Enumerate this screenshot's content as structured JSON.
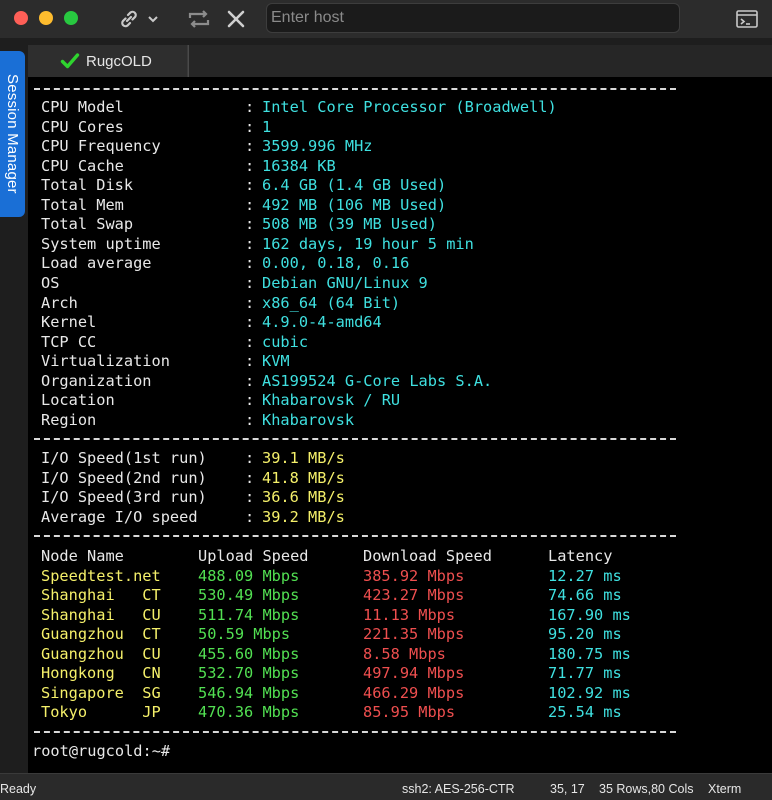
{
  "window": {
    "host_placeholder": "Enter host",
    "icons": [
      "link-icon",
      "chevron-down-icon",
      "reconnect-icon",
      "close-icon",
      "terminal-panel-icon"
    ]
  },
  "sidebar": {
    "session_manager_label": "Session Manager"
  },
  "tabs": [
    {
      "label": "RugcOLD",
      "status_icon": "check-icon"
    }
  ],
  "terminal": {
    "system_info": [
      {
        "key": "CPU Model",
        "value": "Intel Core Processor (Broadwell)"
      },
      {
        "key": "CPU Cores",
        "value": "1"
      },
      {
        "key": "CPU Frequency",
        "value": "3599.996 MHz"
      },
      {
        "key": "CPU Cache",
        "value": "16384 KB"
      },
      {
        "key": "Total Disk",
        "value": "6.4 GB (1.4 GB Used)"
      },
      {
        "key": "Total Mem",
        "value": "492 MB (106 MB Used)"
      },
      {
        "key": "Total Swap",
        "value": "508 MB (39 MB Used)"
      },
      {
        "key": "System uptime",
        "value": "162 days, 19 hour 5 min"
      },
      {
        "key": "Load average",
        "value": "0.00, 0.18, 0.16"
      },
      {
        "key": "OS",
        "value": "Debian GNU/Linux 9"
      },
      {
        "key": "Arch",
        "value": "x86_64 (64 Bit)"
      },
      {
        "key": "Kernel",
        "value": "4.9.0-4-amd64"
      },
      {
        "key": "TCP CC",
        "value": "cubic"
      },
      {
        "key": "Virtualization",
        "value": "KVM"
      },
      {
        "key": "Organization",
        "value": "AS199524 G-Core Labs S.A."
      },
      {
        "key": "Location",
        "value": "Khabarovsk / RU"
      },
      {
        "key": "Region",
        "value": "Khabarovsk"
      }
    ],
    "io_tests": [
      {
        "key": "I/O Speed(1st run)",
        "value": "39.1 MB/s"
      },
      {
        "key": "I/O Speed(2nd run)",
        "value": "41.8 MB/s"
      },
      {
        "key": "I/O Speed(3rd run)",
        "value": "36.6 MB/s"
      },
      {
        "key": "Average I/O speed",
        "value": "39.2 MB/s"
      }
    ],
    "speedtest_headers": [
      "Node Name",
      "Upload Speed",
      "Download Speed",
      "Latency"
    ],
    "speedtest_rows": [
      {
        "node": "Speedtest.net",
        "upload": "488.09 Mbps",
        "download": "385.92 Mbps",
        "latency": "12.27 ms"
      },
      {
        "node": "Shanghai   CT",
        "upload": "530.49 Mbps",
        "download": "423.27 Mbps",
        "latency": "74.66 ms"
      },
      {
        "node": "Shanghai   CU",
        "upload": "511.74 Mbps",
        "download": "11.13 Mbps",
        "latency": "167.90 ms"
      },
      {
        "node": "Guangzhou  CT",
        "upload": "50.59 Mbps",
        "download": "221.35 Mbps",
        "latency": "95.20 ms"
      },
      {
        "node": "Guangzhou  CU",
        "upload": "455.60 Mbps",
        "download": "8.58 Mbps",
        "latency": "180.75 ms"
      },
      {
        "node": "Hongkong   CN",
        "upload": "532.70 Mbps",
        "download": "497.94 Mbps",
        "latency": "71.77 ms"
      },
      {
        "node": "Singapore  SG",
        "upload": "546.94 Mbps",
        "download": "466.29 Mbps",
        "latency": "102.92 ms"
      },
      {
        "node": "Tokyo      JP",
        "upload": "470.36 Mbps",
        "download": "85.95 Mbps",
        "latency": "25.54 ms"
      }
    ],
    "prompt": "root@rugcold:~#"
  },
  "statusbar": {
    "status": "Ready",
    "encryption": "ssh2: AES-256-CTR",
    "cursor": "35, 17",
    "size": "35 Rows,80 Cols",
    "term_type": "Xterm"
  },
  "colors": {
    "key": "#e8e8e8",
    "info_value": "#3fe0e0",
    "io_value": "#f5f06a",
    "upload": "#52e052",
    "download": "#ef4f4f",
    "latency": "#3fe0e0",
    "session_tab": "#1a6fd6"
  }
}
